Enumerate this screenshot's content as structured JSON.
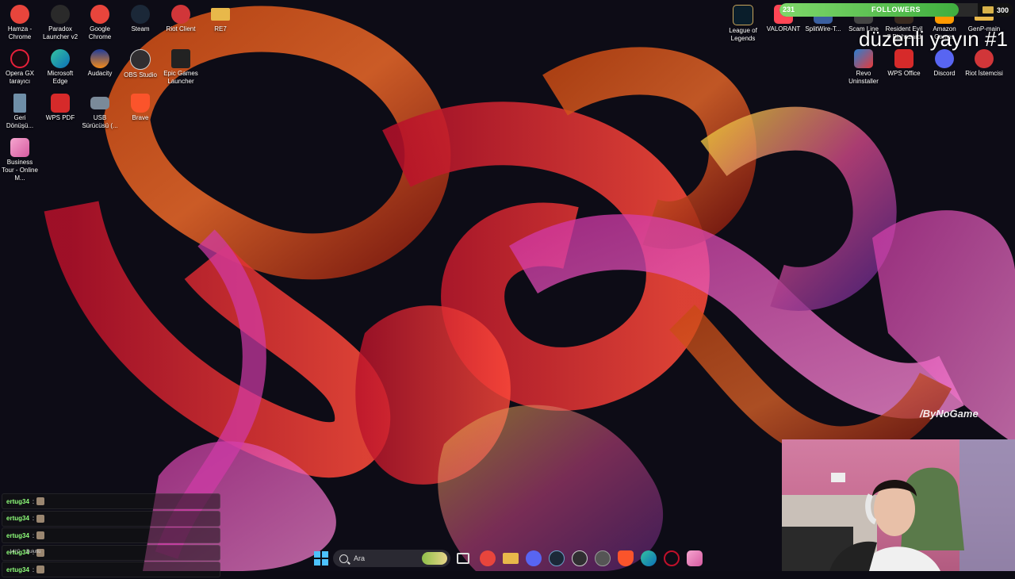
{
  "desktop": {
    "left_icons": [
      {
        "label": "Hamza - Chrome",
        "icon": "chrome-icon",
        "color": "#e8453c"
      },
      {
        "label": "Paradox Launcher v2",
        "icon": "paradox-icon",
        "color": "#2a2a2a"
      },
      {
        "label": "Google Chrome",
        "icon": "chrome-icon",
        "color": "#e8453c"
      },
      {
        "label": "Steam",
        "icon": "steam-icon",
        "color": "#1b2838"
      },
      {
        "label": "Riot Client",
        "icon": "riot-icon",
        "color": "#d13639"
      },
      {
        "label": "RE7",
        "icon": "folder-icon",
        "color": "#e8b84a"
      },
      {
        "label": "Opera GX tarayıcı",
        "icon": "opera-gx-icon",
        "color": "#1a0a10"
      },
      {
        "label": "Microsoft Edge",
        "icon": "edge-icon",
        "color": "#0c6fb8"
      },
      {
        "label": "Audacity",
        "icon": "audacity-icon",
        "color": "#1f3c9a"
      },
      {
        "label": "OBS Studio",
        "icon": "obs-icon",
        "color": "#302e31"
      },
      {
        "label": "Epic Games Launcher",
        "icon": "epic-games-icon",
        "color": "#222222"
      },
      {
        "label": "Geri Dönüşü...",
        "icon": "recycle-bin-icon",
        "color": "#6f8fa8"
      },
      {
        "label": "WPS PDF",
        "icon": "wps-pdf-icon",
        "color": "#d62a2a"
      },
      {
        "label": "USB Sürücüsü (...",
        "icon": "usb-drive-icon",
        "color": "#7a8a99"
      },
      {
        "label": "Brave",
        "icon": "brave-icon",
        "color": "#fb542b"
      },
      {
        "label": "Business Tour - Online M...",
        "icon": "business-tour-icon",
        "color": "#d65aa0"
      }
    ],
    "right_icons": [
      {
        "label": "League of Legends",
        "icon": "league-icon",
        "color": "#0a1e2b"
      },
      {
        "label": "VALORANT",
        "icon": "valorant-icon",
        "color": "#ff4655"
      },
      {
        "label": "SplitWire-T...",
        "icon": "splitwire-icon",
        "color": "#3a5fa0"
      },
      {
        "label": "Scam Line",
        "icon": "scam-line-icon",
        "color": "#444444"
      },
      {
        "label": "Resident Evil 7 Biohazard",
        "icon": "re7-icon",
        "color": "#3a2a20"
      },
      {
        "label": "Amazon Games",
        "icon": "amazon-games-icon",
        "color": "#ff9900"
      },
      {
        "label": "GenP-main",
        "icon": "folder-icon",
        "color": "#e8b84a"
      },
      {
        "label": "Revo Uninstaller",
        "icon": "revo-icon",
        "color": "#2a7fd0"
      },
      {
        "label": "WPS Office",
        "icon": "wps-office-icon",
        "color": "#d62a2a"
      },
      {
        "label": "Discord",
        "icon": "discord-icon",
        "color": "#5865f2"
      },
      {
        "label": "Riot İstemcisi",
        "icon": "riot-icon",
        "color": "#d13639"
      }
    ]
  },
  "overlay": {
    "followers_label": "FOLLOWERS",
    "followers_count": "231",
    "followers_goal": "300",
    "followers_progress": 0.77,
    "stream_title": "düzenli yayın #1",
    "watermark": "/ByNoGame"
  },
  "chat": {
    "messages": [
      {
        "user": "ertug34",
        "sep": ":"
      },
      {
        "user": "ertug34",
        "sep": ":"
      },
      {
        "user": "ertug34",
        "sep": ":"
      },
      {
        "user": "ertug34",
        "sep": ":"
      },
      {
        "user": "ertug34",
        "sep": ":"
      }
    ],
    "weather_temp": "14°C",
    "weather_desc": "Bulutlu"
  },
  "taskbar": {
    "search_placeholder": "Ara",
    "apps": [
      {
        "icon": "task-view-icon",
        "color": "#dddddd"
      },
      {
        "icon": "chrome-icon",
        "color": "#e8453c"
      },
      {
        "icon": "file-explorer-icon",
        "color": "#e8b84a"
      },
      {
        "icon": "discord-icon",
        "color": "#5865f2"
      },
      {
        "icon": "steam-icon",
        "color": "#1b2838"
      },
      {
        "icon": "obs-icon",
        "color": "#302e31"
      },
      {
        "icon": "obs-recording-icon",
        "color": "#555555"
      },
      {
        "icon": "brave-icon",
        "color": "#fb542b"
      },
      {
        "icon": "edge-icon",
        "color": "#0c6fb8"
      },
      {
        "icon": "opera-gx-icon",
        "color": "#c0102a"
      },
      {
        "icon": "business-tour-icon",
        "color": "#d65aa0"
      }
    ]
  },
  "colors": {
    "accent_green": "#5fc85a",
    "background": "#0c0b14"
  }
}
